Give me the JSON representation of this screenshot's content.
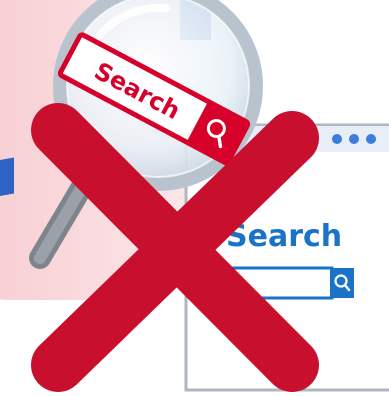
{
  "magnifier": {
    "search_label": "Search",
    "button_icon": "search-icon"
  },
  "browser_window": {
    "search_label": "Search",
    "button_icon": "search-icon"
  },
  "overlay": {
    "icon": "cross-mark-icon"
  },
  "colors": {
    "pink_bg": "#f9dde0",
    "blue_accent": "#2f63c4",
    "red_search": "#d6002a",
    "cross_red": "#c8102e",
    "window_border": "#aeb7c2",
    "window_bar": "#e8eef7",
    "search_blue": "#1a73c8"
  }
}
